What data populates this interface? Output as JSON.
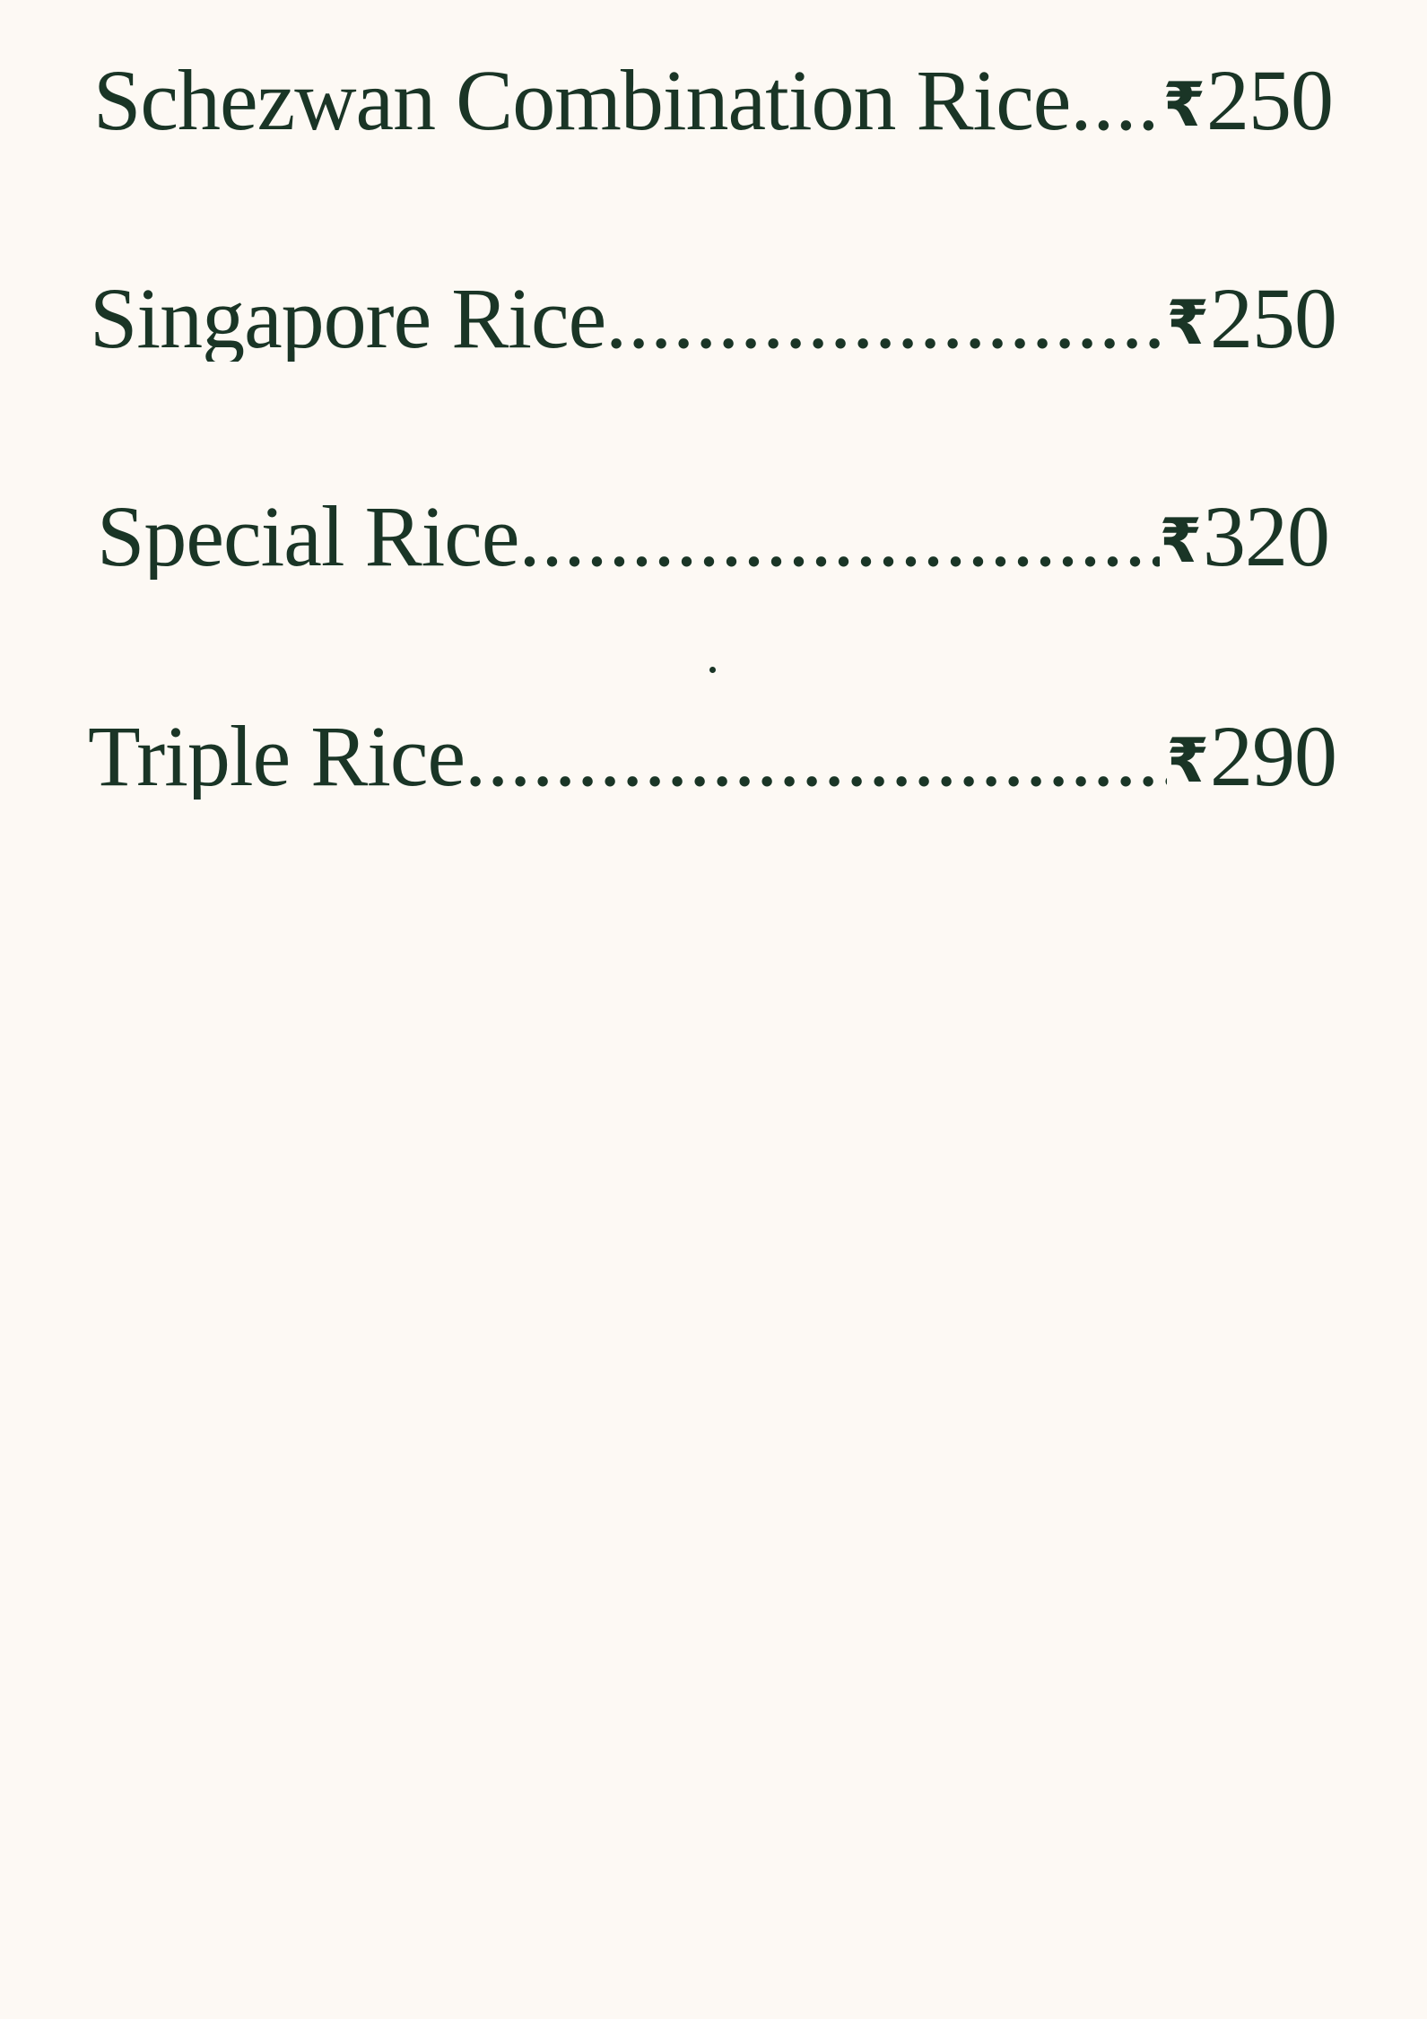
{
  "menu": {
    "currency_symbol": "₹",
    "items": [
      {
        "name": "Schezwan Combination Rice",
        "price": "250"
      },
      {
        "name": "Singapore Rice",
        "price": "250"
      },
      {
        "name": "Special Rice",
        "price": "320"
      },
      {
        "name": "Triple Rice",
        "price": "290"
      }
    ]
  },
  "colors": {
    "background": "#fdf9f4",
    "text": "#1a3526"
  }
}
